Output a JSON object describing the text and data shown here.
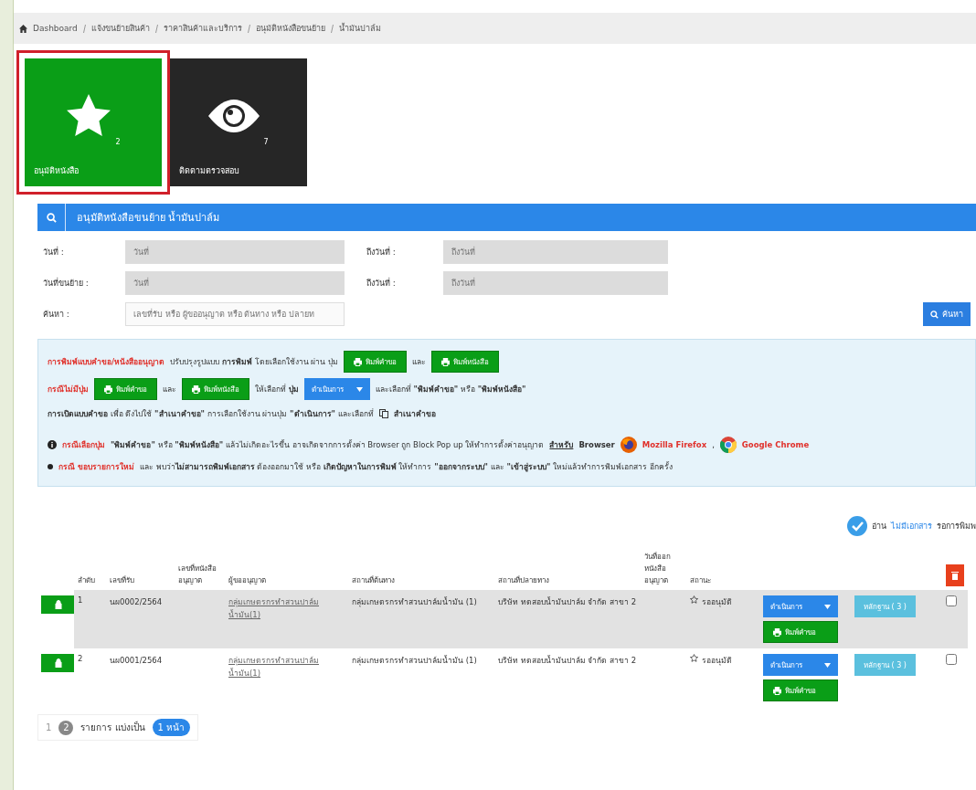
{
  "breadcrumb": [
    "Dashboard",
    "แจ้งขนย้ายสินค้า",
    "ราคาสินค้าและบริการ",
    "อนุมัติหนังสือขนย้าย",
    "น้ำมันปาล์ม"
  ],
  "tiles": [
    {
      "label": "อนุมัติหนังสือ",
      "count": "2",
      "kind": "star",
      "selected": true
    },
    {
      "label": "ติดตามตรวจสอบ",
      "count": "7",
      "kind": "eye",
      "selected": false
    }
  ],
  "panel": {
    "title": "อนุมัติหนังสือขนย้าย น้ำมันปาล์ม"
  },
  "filters": [
    {
      "label": "วันที่ :",
      "placeholder": "วันที่",
      "label2": "ถึงวันที่ :",
      "placeholder2": "ถึงวันที่"
    },
    {
      "label": "วันที่ขนย้าย :",
      "placeholder": "วันที่",
      "label2": "ถึงวันที่ :",
      "placeholder2": "ถึงวันที่"
    },
    {
      "label": "ค้นหา :",
      "placeholder": "เลขที่รับ หรือ ผู้ขออนุญาต หรือ ต้นทาง หรือ ปลายท"
    }
  ],
  "search_button": "ค้นหา",
  "info_lines": [
    [
      {
        "kind": "red",
        "text": "การพิมพ์แบบคำขอ/หนังสืออนุญาต"
      },
      {
        "kind": "text",
        "text": "ปรับปรุงรูปแบบ **การพิมพ์** โดยเลือกใช้งาน ผ่าน ปุ่ม"
      },
      {
        "kind": "print",
        "text": "พิมพ์คำขอ"
      },
      {
        "kind": "text",
        "text": "และ"
      },
      {
        "kind": "print",
        "text": "พิมพ์หนังสือ"
      }
    ],
    [
      {
        "kind": "red",
        "text": "กรณีไม่มีปุ่ม"
      },
      {
        "kind": "print",
        "text": "พิมพ์คำขอ"
      },
      {
        "kind": "text",
        "text": "และ"
      },
      {
        "kind": "print",
        "text": "พิมพ์หนังสือ"
      },
      {
        "kind": "text",
        "text": "ให้เลือกที่ **ปุ่ม**"
      },
      {
        "kind": "dropdown",
        "text": "ดำเนินการ"
      },
      {
        "kind": "text",
        "text": "และเลือกที่ **\"พิมพ์คำขอ\"** หรือ **\"พิมพ์หนังสือ\"**"
      }
    ],
    [
      {
        "kind": "text",
        "text": "**การเปิดแบบคำขอ** เพื่อ ดึงไปใช้ **\"สำเนาคำขอ\"** การเลือกใช้งาน ผ่านปุ่ม **\"ดำเนินการ\"** และเลือกที่"
      },
      {
        "kind": "copy",
        "text": "สำเนาคำขอ"
      }
    ]
  ],
  "notes": [
    [
      {
        "kind": "info-icon"
      },
      {
        "kind": "red",
        "text": "กรณีเลือกปุ่ม"
      },
      {
        "kind": "text",
        "text": "**\"พิมพ์คำขอ\"** หรือ **\"พิมพ์หนังสือ\"** แล้วไม่เกิดอะไรขึ้น อาจเกิดจากการตั้งค่า Browser ถูก Block Pop up ให้ทำการตั้งค่าอนุญาต"
      },
      {
        "kind": "link",
        "text": "สำหรับ"
      },
      {
        "kind": "text",
        "text": "**Browser**"
      },
      {
        "kind": "firefox"
      },
      {
        "kind": "red",
        "text": "Mozilla Firefox"
      },
      {
        "kind": "text",
        "text": ","
      },
      {
        "kind": "chrome"
      },
      {
        "kind": "red",
        "text": "Google Chrome"
      }
    ],
    [
      {
        "kind": "bullet"
      },
      {
        "kind": "red",
        "text": "กรณี ขอบรายการใหม่"
      },
      {
        "kind": "text",
        "text": "และ พบว่า**ไม่สามารถพิมพ์เอกสาร** ต้องออกมาใช้ หรือ **เกิดปัญหาในการพิมพ์** ให้ทำการ **\"ออกจากระบบ\"** และ **\"เข้าสู่ระบบ\"** ใหม่แล้วทำการพิมพ์เอกสาร อีกครั้ง"
      }
    ]
  ],
  "legend": {
    "label": "อ่าน",
    "text": "ไม่มีเอกสาร",
    "text2": "รอการพิมพ"
  },
  "table": {
    "columns": [
      "ลำดับ",
      "เลขที่รับ",
      "เลขที่หนังสืออนุญาต",
      "ผู้ขออนุญาต",
      "สถานที่ต้นทาง",
      "สถานที่ปลายทาง",
      "วันที่ออกหนังสืออนุญาต",
      "สถานะ"
    ],
    "rows": [
      {
        "no": "1",
        "receipt": "นผ0002/2564",
        "license": "",
        "applicant": "กลุ่มเกษตรกรทำสวนปาล์มน้ำมัน(1)",
        "origin": "กลุ่มเกษตรกรทำสวนปาล์มน้ำมัน (1)",
        "destination": "บริษัท ทดสอบน้ำมันปาล์ม จำกัด สาขา 2",
        "issued": "",
        "status": "รออนุมัติ",
        "action": "ดำเนินการ",
        "print": "พิมพ์คำขอ",
        "evidence": "หลักฐาน ( 3 )",
        "selected": true,
        "checked": false
      },
      {
        "no": "2",
        "receipt": "นผ0001/2564",
        "license": "",
        "applicant": "กลุ่มเกษตรกรทำสวนปาล์มน้ำมัน(1)",
        "origin": "กลุ่มเกษตรกรทำสวนปาล์มน้ำมัน (1)",
        "destination": "บริษัท ทดสอบน้ำมันปาล์ม จำกัด สาขา 2",
        "issued": "",
        "status": "รออนุมัติ",
        "action": "ดำเนินการ",
        "print": "พิมพ์คำขอ",
        "evidence": "หลักฐาน ( 3 )",
        "selected": false,
        "checked": false
      }
    ]
  },
  "pagination": {
    "page": "1",
    "count": "2",
    "text": "รายการ แบ่งเป็น",
    "pages": "1 หน้า"
  }
}
